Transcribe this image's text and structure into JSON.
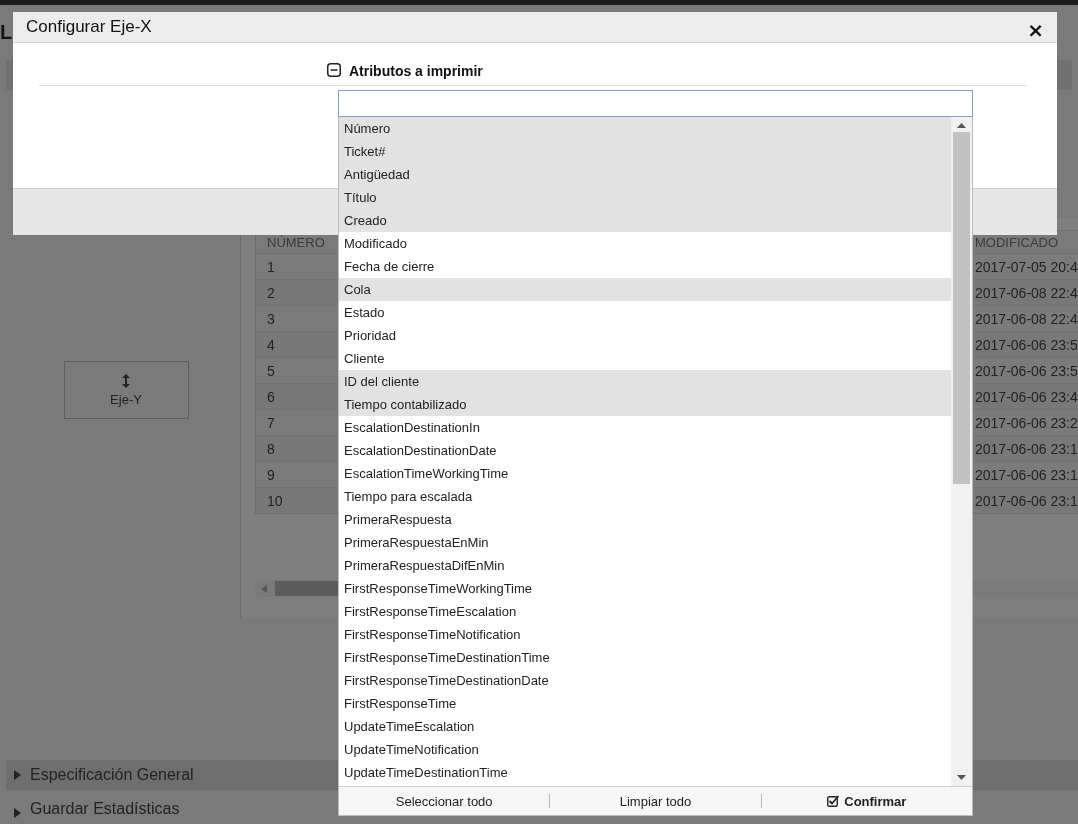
{
  "page": {
    "title": "L",
    "y_axis_button": "Eje-Y",
    "table": {
      "columns": [
        "NÚMERO",
        "MODIFICADO"
      ],
      "rows": [
        [
          "1",
          "2017-07-05 20:4"
        ],
        [
          "2",
          "2017-06-08 22:4"
        ],
        [
          "3",
          "2017-06-08 22:4"
        ],
        [
          "4",
          "2017-06-06 23:5"
        ],
        [
          "5",
          "2017-06-06 23:5"
        ],
        [
          "6",
          "2017-06-06 23:4"
        ],
        [
          "7",
          "2017-06-06 23:2"
        ],
        [
          "8",
          "2017-06-06 23:1"
        ],
        [
          "9",
          "2017-06-06 23:1"
        ],
        [
          "10",
          "2017-06-06 23:1"
        ]
      ]
    },
    "sections": [
      {
        "label": "Especificación General",
        "expanded": false
      },
      {
        "label": "Guardar Estadísticas",
        "expanded": false
      }
    ]
  },
  "dialog": {
    "title": "Configurar Eje-X",
    "close": "×",
    "group": {
      "label": "Atributos a imprimir",
      "expanded": true
    },
    "options": [
      {
        "label": "Número",
        "selected": true
      },
      {
        "label": "Ticket#",
        "selected": true
      },
      {
        "label": "Antigüedad",
        "selected": true
      },
      {
        "label": "Título",
        "selected": true
      },
      {
        "label": "Creado",
        "selected": true
      },
      {
        "label": "Modificado",
        "selected": false
      },
      {
        "label": "Fecha de cierre",
        "selected": false
      },
      {
        "label": "Cola",
        "selected": true
      },
      {
        "label": "Estado",
        "selected": false
      },
      {
        "label": "Prioridad",
        "selected": false
      },
      {
        "label": "Cliente",
        "selected": false
      },
      {
        "label": "ID del cliente",
        "selected": true
      },
      {
        "label": "Tiempo contabilizado",
        "selected": true
      },
      {
        "label": "EscalationDestinationIn",
        "selected": false
      },
      {
        "label": "EscalationDestinationDate",
        "selected": false
      },
      {
        "label": "EscalationTimeWorkingTime",
        "selected": false
      },
      {
        "label": "Tiempo para escalada",
        "selected": false
      },
      {
        "label": "PrimeraRespuesta",
        "selected": false
      },
      {
        "label": "PrimeraRespuestaEnMin",
        "selected": false
      },
      {
        "label": "PrimeraRespuestaDifEnMin",
        "selected": false
      },
      {
        "label": "FirstResponseTimeWorkingTime",
        "selected": false
      },
      {
        "label": "FirstResponseTimeEscalation",
        "selected": false
      },
      {
        "label": "FirstResponseTimeNotification",
        "selected": false
      },
      {
        "label": "FirstResponseTimeDestinationTime",
        "selected": false
      },
      {
        "label": "FirstResponseTimeDestinationDate",
        "selected": false
      },
      {
        "label": "FirstResponseTime",
        "selected": false
      },
      {
        "label": "UpdateTimeEscalation",
        "selected": false
      },
      {
        "label": "UpdateTimeNotification",
        "selected": false
      },
      {
        "label": "UpdateTimeDestinationTime",
        "selected": false
      }
    ],
    "actions": [
      {
        "label": "Seleccionar todo",
        "kind": "select_all"
      },
      {
        "label": "Limpiar todo",
        "kind": "clear_all"
      },
      {
        "label": "Confirmar",
        "kind": "confirm"
      }
    ]
  }
}
